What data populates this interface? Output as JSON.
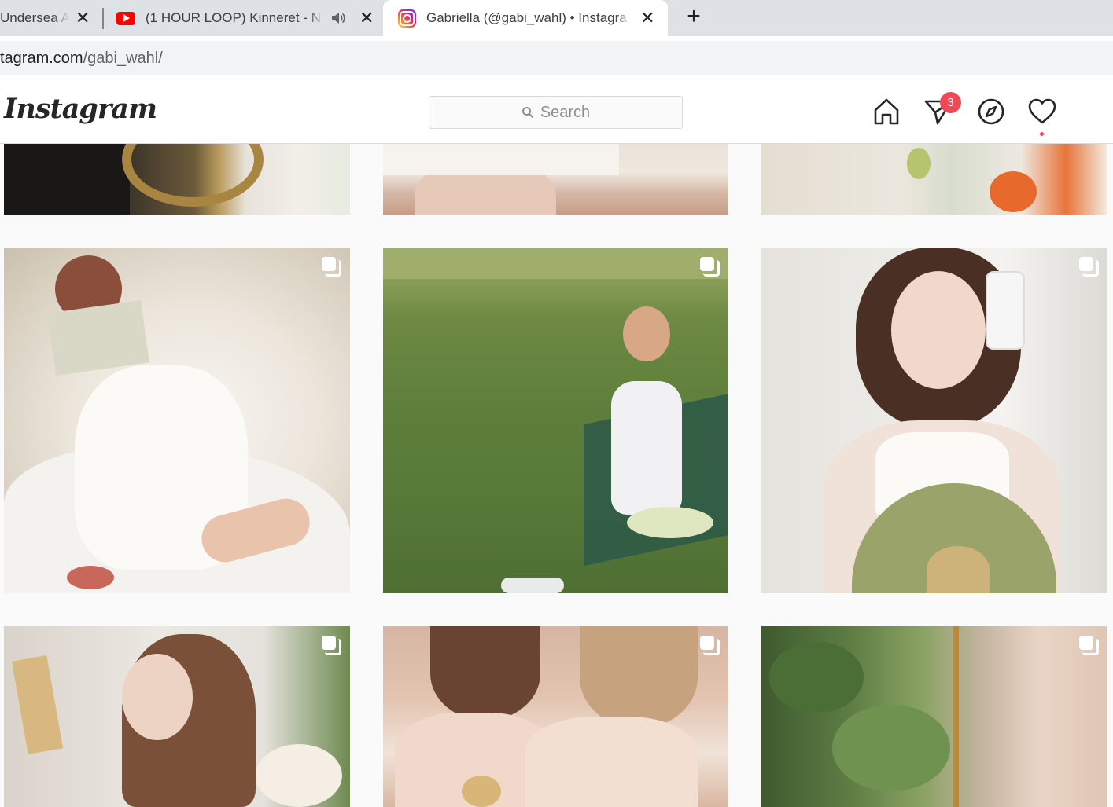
{
  "browser": {
    "tabs": [
      {
        "title": "Undersea A",
        "close": "✕"
      },
      {
        "title": "(1 HOUR LOOP) Kinneret - N",
        "close": "✕"
      },
      {
        "title": "Gabriella (@gabi_wahl) • Instagra",
        "close": "✕"
      }
    ],
    "new_tab": "+",
    "url_host": "tagram.com",
    "url_path": "/gabi_wahl/"
  },
  "instagram": {
    "logo": "Instagram",
    "search_placeholder": "Search",
    "direct_badge": "3"
  },
  "posts": [
    {
      "name": "post-top-1",
      "multi": false
    },
    {
      "name": "post-top-2",
      "multi": false
    },
    {
      "name": "post-top-3",
      "multi": false
    },
    {
      "name": "post-reading-book",
      "multi": true
    },
    {
      "name": "post-bench-field",
      "multi": true
    },
    {
      "name": "post-mirror-selfie-fan",
      "multi": true
    },
    {
      "name": "post-reading-flowers",
      "multi": true
    },
    {
      "name": "post-two-women-pearls",
      "multi": true
    },
    {
      "name": "post-plants-chain",
      "multi": true
    }
  ],
  "colors": {
    "tabstrip": "#dee1e6",
    "badge": "#ed4956",
    "youtube_red": "#ff0000"
  }
}
